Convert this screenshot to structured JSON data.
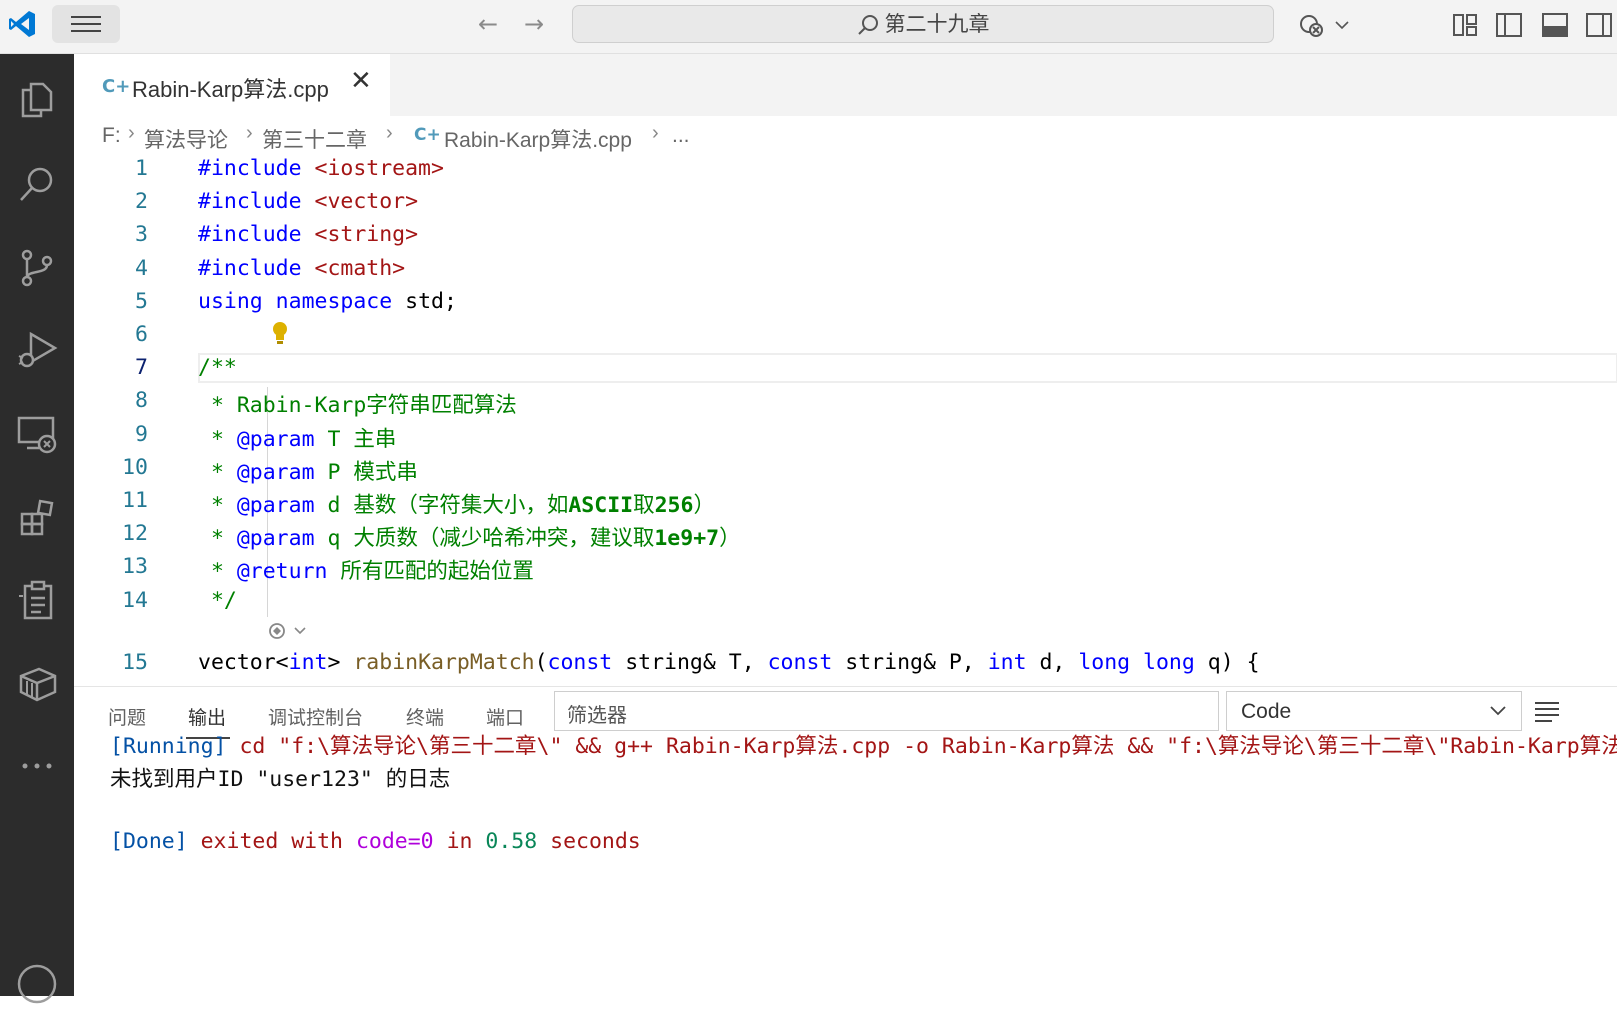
{
  "titlebar": {
    "search": "第二十九章",
    "back": "←",
    "forward": "→"
  },
  "tab": {
    "label": "Rabin-Karp算法.cpp",
    "icon": "C+",
    "close": "✕"
  },
  "breadcrumb": {
    "drive": "F:",
    "folder1": "算法导论",
    "folder2": "第三十二章",
    "file": "Rabin-Karp算法.cpp",
    "more": "..."
  },
  "editor": {
    "lines": [
      {
        "n": "1",
        "pre": "#include",
        "rest": " <iostream>"
      },
      {
        "n": "2",
        "pre": "#include",
        "rest": " <vector>"
      },
      {
        "n": "3",
        "pre": "#include",
        "rest": " <string>"
      },
      {
        "n": "4",
        "pre": "#include",
        "rest": " <cmath>"
      },
      {
        "n": "5",
        "kw1": "using",
        "kw2": " namespace",
        "rest": " std;"
      },
      {
        "n": "6"
      },
      {
        "n": "7",
        "cm": "/**"
      },
      {
        "n": "8",
        "cm": " * Rabin-Karp字符串匹配算法"
      },
      {
        "n": "9",
        "cm1": " * ",
        "tag": "@param",
        "cm2": " T 主串"
      },
      {
        "n": "10",
        "cm1": " * ",
        "tag": "@param",
        "cm2": " P 模式串"
      },
      {
        "n": "11",
        "cm1": " * ",
        "tag": "@param",
        "cm2": " d 基数（字符集大小，如",
        "b": "ASCII",
        "cm3": "取",
        "b2": "256",
        "cm4": "）"
      },
      {
        "n": "12",
        "cm1": " * ",
        "tag": "@param",
        "cm2": " q 大质数（减少哈希冲突，建议取",
        "b": "1e9+7",
        "cm3": "）"
      },
      {
        "n": "13",
        "cm1": " * ",
        "tag": "@return",
        "cm2": " 所有匹配的起始位置"
      },
      {
        "n": "14",
        "cm": " */"
      },
      {
        "n": "15",
        "a": "vector",
        "b": "<",
        "c": "int",
        "d": "> ",
        "e": "rabinKarpMatch",
        "f": "(",
        "g": "const",
        "h": " string& T, ",
        "i": "const",
        "j": " string& P, ",
        "k": "int",
        "l": " d, ",
        "m": "long long",
        "o": " q) {"
      }
    ]
  },
  "panel": {
    "tabs": [
      "问题",
      "输出",
      "调试控制台",
      "终端",
      "端口"
    ],
    "filter_placeholder": "筛选器",
    "channel": "Code",
    "output": {
      "l1_running": "[Running]",
      "l1_cmd": " cd \"f:\\算法导论\\第三十二章\\\" && g++ Rabin-Karp算法.cpp -o Rabin-Karp算法 && \"f:\\算法导论\\第三十二章\\\"Rabin-Karp算法",
      "l2": "未找到用户ID \"user123\" 的日志",
      "l4_done": "[Done]",
      "l4_exited": " exited with ",
      "l4_code": "code=0",
      "l4_in": " in ",
      "l4_num": "0.58",
      "l4_seconds": " seconds"
    }
  }
}
